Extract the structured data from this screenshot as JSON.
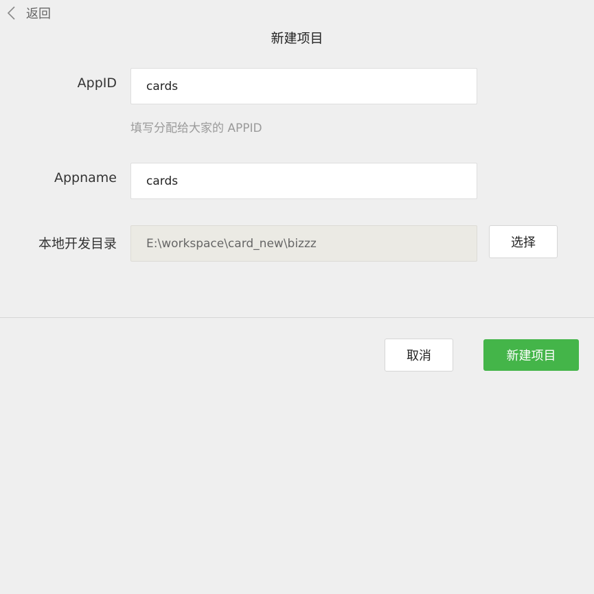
{
  "header": {
    "back_label": "返回",
    "title": "新建项目"
  },
  "form": {
    "appid": {
      "label": "AppID",
      "value": "cards",
      "hint": "填写分配给大家的 APPID"
    },
    "appname": {
      "label": "Appname",
      "value": "cards"
    },
    "directory": {
      "label": "本地开发目录",
      "value": "E:\\workspace\\card_new\\bizzz",
      "choose_label": "选择"
    }
  },
  "footer": {
    "cancel_label": "取消",
    "create_label": "新建项目"
  },
  "colors": {
    "background": "#efefef",
    "primary": "#44b549",
    "readonly_field": "#ebeae4",
    "hint_text": "#9a9a9a"
  },
  "icons": {
    "back": "chevron-left-icon"
  }
}
